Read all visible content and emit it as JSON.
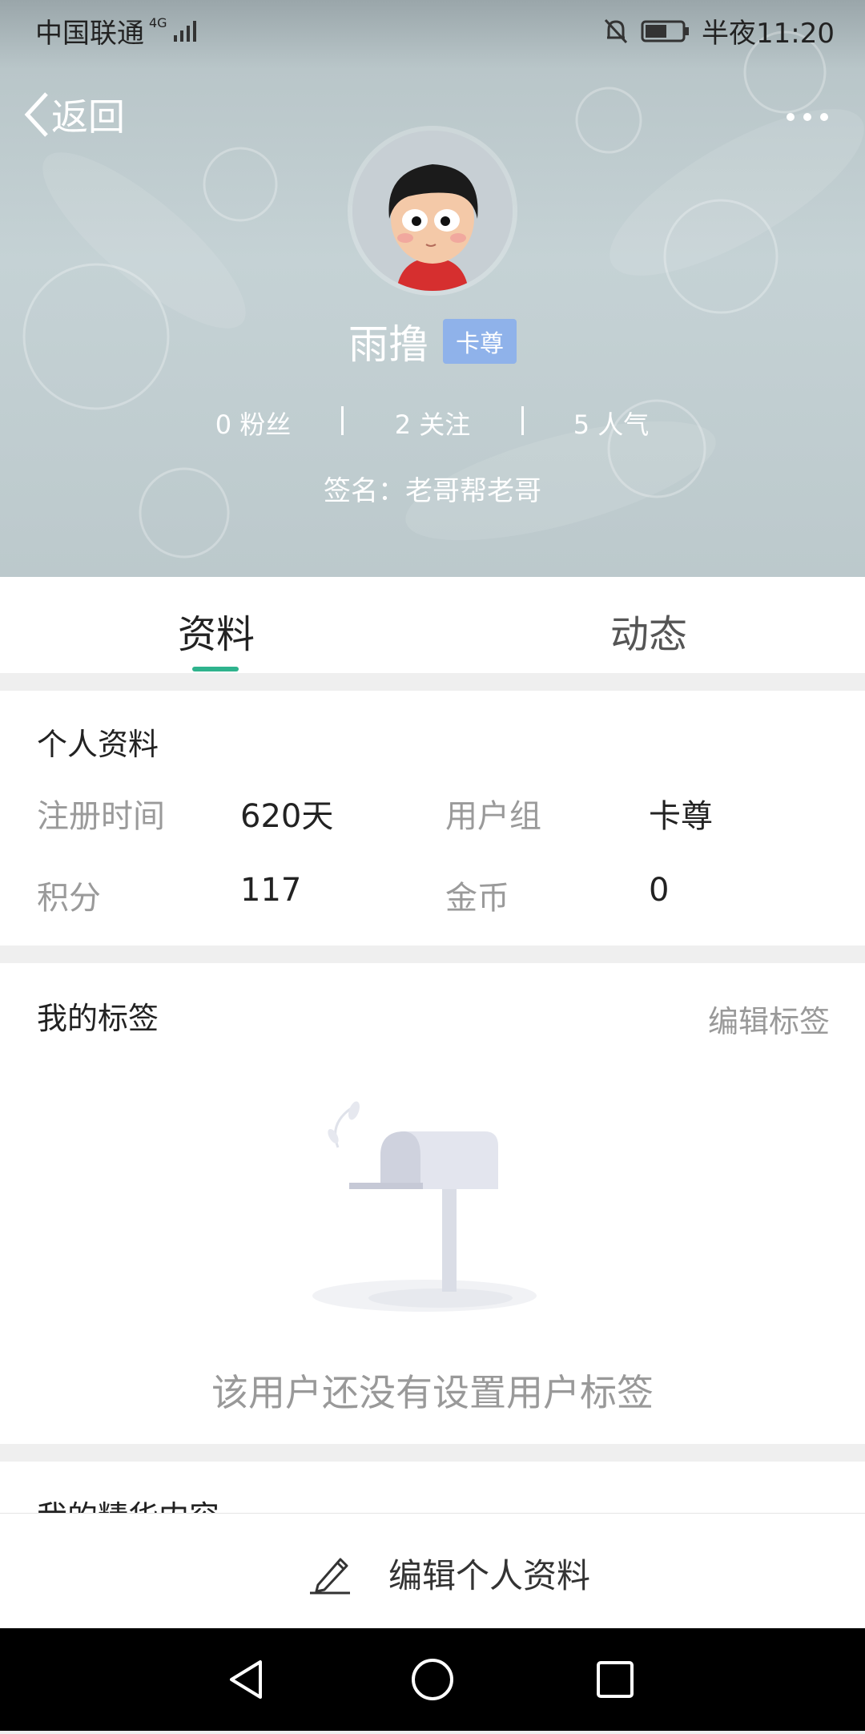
{
  "status_bar": {
    "carrier": "中国联通",
    "network": "4G",
    "time": "半夜11:20",
    "icons": [
      "signal-icon",
      "mute-bell-icon",
      "battery-icon"
    ]
  },
  "navbar": {
    "back_label": "返回",
    "more_icon": "more-dots-icon"
  },
  "profile": {
    "name": "雨撸",
    "badge": "卡尊",
    "stats": [
      {
        "label": "0 粉丝"
      },
      {
        "label": "2 关注"
      },
      {
        "label": "5 人气"
      }
    ],
    "signature": "签名：老哥帮老哥"
  },
  "tabs": [
    {
      "label": "资料",
      "active": true
    },
    {
      "label": "动态",
      "active": false
    }
  ],
  "personal_info": {
    "title": "个人资料",
    "fields": [
      {
        "label": "注册时间",
        "value": "620天"
      },
      {
        "label": "用户组",
        "value": "卡尊"
      },
      {
        "label": "积分",
        "value": "117"
      },
      {
        "label": "金币",
        "value": "0"
      }
    ]
  },
  "tags_section": {
    "title": "我的标签",
    "edit_label": "编辑标签",
    "empty_text": "该用户还没有设置用户标签"
  },
  "featured_section": {
    "title": "我的精华内容"
  },
  "bottom_action": {
    "label": "编辑个人资料",
    "icon": "pencil-icon"
  },
  "colors": {
    "accent": "#2fb38d",
    "badge": "#8fb2ea",
    "header_bg": "#bcc9cc"
  }
}
